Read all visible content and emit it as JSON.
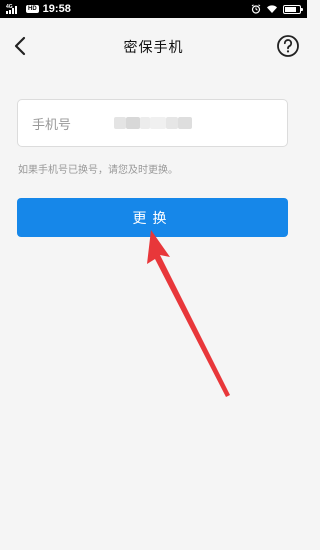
{
  "status_bar": {
    "network": "4G",
    "hd_badge": "HD",
    "time": "19:58",
    "battery_level": 0.8
  },
  "header": {
    "title": "密保手机",
    "back_icon": "chevron-left-icon",
    "help_icon": "question-circle-icon"
  },
  "phone_field": {
    "label": "手机号",
    "value_masked": true
  },
  "hint": "如果手机号已换号，请您及时更换。",
  "primary_button": {
    "label": "更换",
    "color": "#1687e9"
  },
  "annotation": {
    "arrow_color": "#e8373a"
  }
}
